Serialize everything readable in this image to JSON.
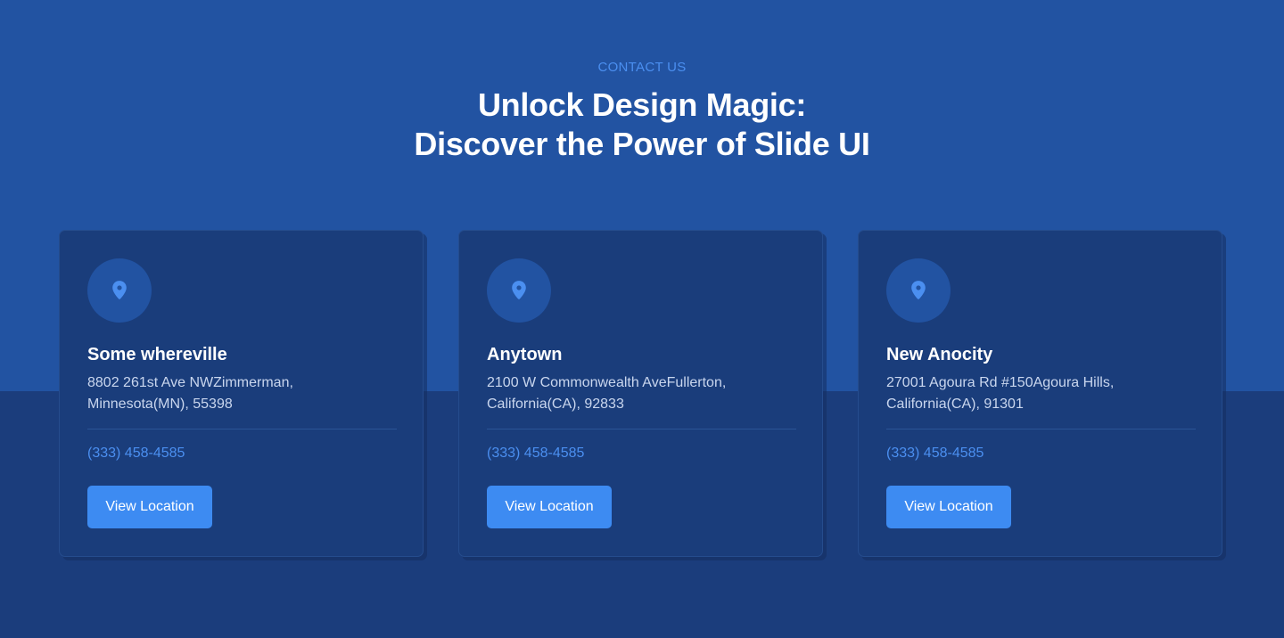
{
  "header": {
    "eyebrow": "CONTACT US",
    "title_line1": "Unlock Design Magic:",
    "title_line2": "Discover the Power of Slide UI"
  },
  "colors": {
    "top_background": "#2253a2",
    "bottom_background": "#1b3d7c",
    "card_background": "#1a3d7b",
    "accent": "#3d8bf2",
    "link": "#4b8ff0"
  },
  "locations": [
    {
      "icon": "map-pin-icon",
      "name": "Some whereville",
      "address_line1": "8802 261st Ave NWZimmerman,",
      "address_line2": "Minnesota(MN), 55398",
      "phone": "(333) 458-4585",
      "button_label": "View Location"
    },
    {
      "icon": "map-pin-icon",
      "name": "Anytown",
      "address_line1": "2100 W Commonwealth AveFullerton,",
      "address_line2": "California(CA), 92833",
      "phone": "(333) 458-4585",
      "button_label": "View Location"
    },
    {
      "icon": "map-pin-icon",
      "name": "New Anocity",
      "address_line1": "27001 Agoura Rd #150Agoura Hills,",
      "address_line2": "California(CA), 91301",
      "phone": "(333) 458-4585",
      "button_label": "View Location"
    }
  ]
}
